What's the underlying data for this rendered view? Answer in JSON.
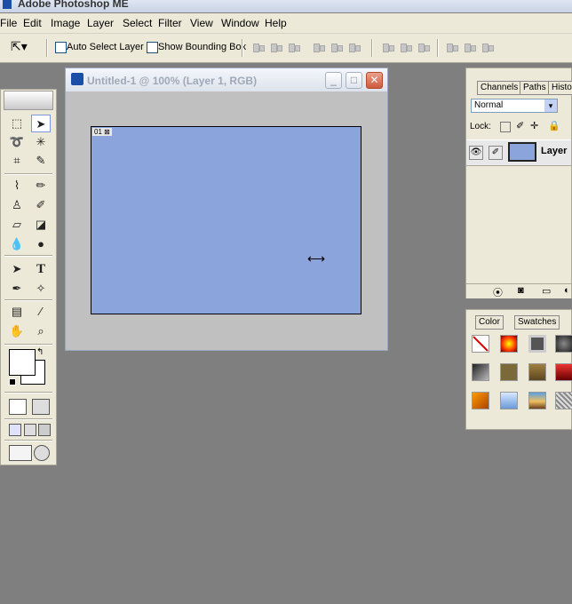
{
  "app": {
    "title": "Adobe Photoshop ME"
  },
  "menu": [
    "File",
    "Edit",
    "Image",
    "Layer",
    "Select",
    "Filter",
    "View",
    "Window",
    "Help"
  ],
  "options": {
    "auto_select_label": "Auto Select Layer",
    "bounding_box_label": "Show Bounding Box"
  },
  "document": {
    "title": "Untitled-1 @ 100% (Layer 1, RGB)",
    "slice_label": "01",
    "canvas_color": "#8ca4dc"
  },
  "layers_panel": {
    "tabs": [
      "Channels",
      "Paths",
      "Histo"
    ],
    "blend_mode": "Normal",
    "lock_label": "Lock:",
    "layer_name": "Layer"
  },
  "color_panel": {
    "tabs": [
      "Color",
      "Swatches"
    ]
  },
  "colors": {
    "workspace": "#7f7f7f",
    "panel": "#ece9d8",
    "canvas": "#8ca4dc",
    "close_button": "#cf5a3b"
  }
}
